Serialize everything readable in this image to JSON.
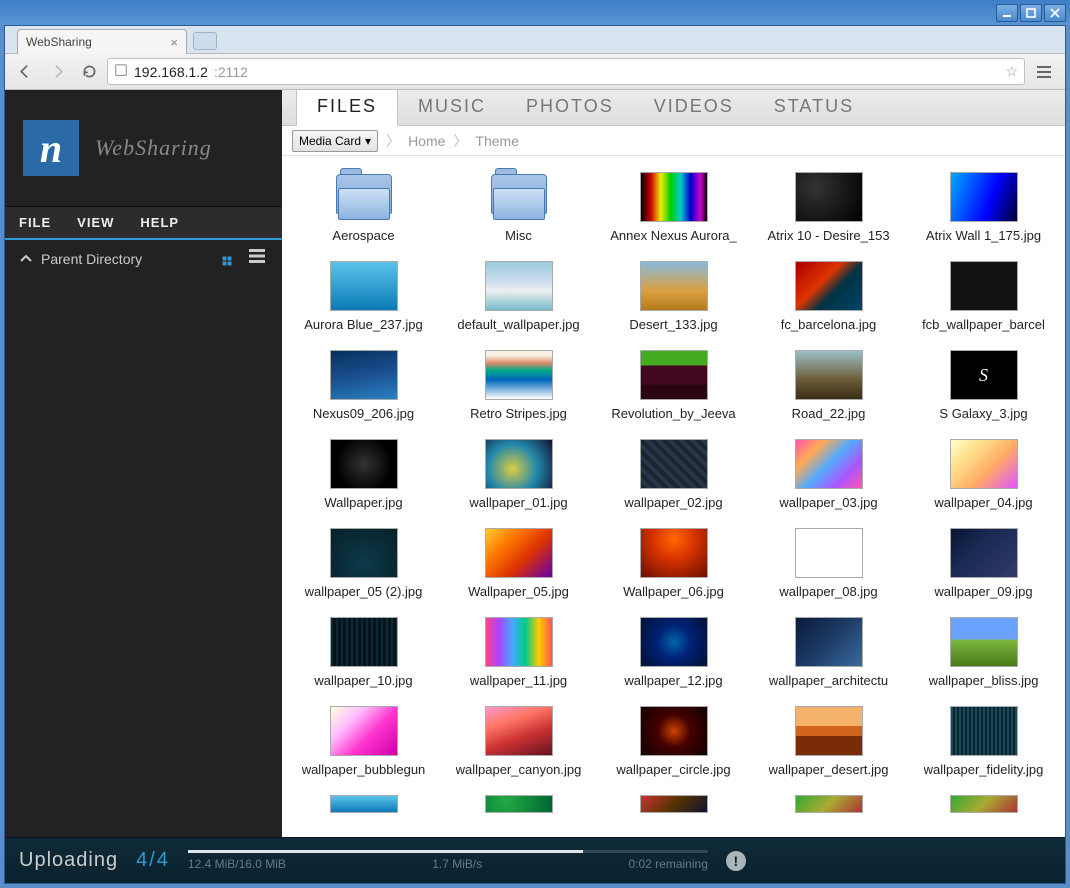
{
  "window": {
    "title": "WebSharing"
  },
  "browser": {
    "tab_title": "WebSharing",
    "url_host": "192.168.1.2",
    "url_port": ":2112"
  },
  "sidebar": {
    "app_name": "WebSharing",
    "menu": {
      "file": "FILE",
      "view": "VIEW",
      "help": "HELP"
    },
    "parent_dir": "Parent Directory"
  },
  "tabs": [
    {
      "id": "files",
      "label": "FILES",
      "active": true
    },
    {
      "id": "music",
      "label": "MUSIC",
      "active": false
    },
    {
      "id": "photos",
      "label": "PHOTOS",
      "active": false
    },
    {
      "id": "videos",
      "label": "VIDEOS",
      "active": false
    },
    {
      "id": "status",
      "label": "STATUS",
      "active": false
    }
  ],
  "breadcrumb": {
    "root_selector": "Media Card",
    "items": [
      "Home",
      "Theme"
    ]
  },
  "items": [
    {
      "name": "Aerospace",
      "type": "folder"
    },
    {
      "name": "Misc",
      "type": "folder"
    },
    {
      "name": "Annex Nexus Aurora_",
      "thumb": "t1"
    },
    {
      "name": "Atrix 10 - Desire_153",
      "thumb": "t2"
    },
    {
      "name": "Atrix Wall 1_175.jpg",
      "thumb": "t3"
    },
    {
      "name": "Aurora Blue_237.jpg",
      "thumb": "t4"
    },
    {
      "name": "default_wallpaper.jpg",
      "thumb": "t5"
    },
    {
      "name": "Desert_133.jpg",
      "thumb": "t6"
    },
    {
      "name": "fc_barcelona.jpg",
      "thumb": "t7"
    },
    {
      "name": "fcb_wallpaper_barcel",
      "thumb": "t8"
    },
    {
      "name": "Nexus09_206.jpg",
      "thumb": "t9"
    },
    {
      "name": "Retro Stripes.jpg",
      "thumb": "t10"
    },
    {
      "name": "Revolution_by_Jeeva",
      "thumb": "t11"
    },
    {
      "name": "Road_22.jpg",
      "thumb": "t12"
    },
    {
      "name": "S Galaxy_3.jpg",
      "thumb": "t13"
    },
    {
      "name": "Wallpaper.jpg",
      "thumb": "t14"
    },
    {
      "name": "wallpaper_01.jpg",
      "thumb": "t15"
    },
    {
      "name": "wallpaper_02.jpg",
      "thumb": "t16"
    },
    {
      "name": "wallpaper_03.jpg",
      "thumb": "t17"
    },
    {
      "name": "wallpaper_04.jpg",
      "thumb": "t18"
    },
    {
      "name": "wallpaper_05 (2).jpg",
      "thumb": "t19"
    },
    {
      "name": "Wallpaper_05.jpg",
      "thumb": "t20"
    },
    {
      "name": "Wallpaper_06.jpg",
      "thumb": "t21"
    },
    {
      "name": "wallpaper_08.jpg",
      "thumb": "t22"
    },
    {
      "name": "wallpaper_09.jpg",
      "thumb": "t23"
    },
    {
      "name": "wallpaper_10.jpg",
      "thumb": "t24"
    },
    {
      "name": "wallpaper_11.jpg",
      "thumb": "t25"
    },
    {
      "name": "wallpaper_12.jpg",
      "thumb": "t26"
    },
    {
      "name": "wallpaper_architectu",
      "thumb": "t27"
    },
    {
      "name": "wallpaper_bliss.jpg",
      "thumb": "t28"
    },
    {
      "name": "wallpaper_bubblegun",
      "thumb": "t29"
    },
    {
      "name": "wallpaper_canyon.jpg",
      "thumb": "t30"
    },
    {
      "name": "wallpaper_circle.jpg",
      "thumb": "t31"
    },
    {
      "name": "wallpaper_desert.jpg",
      "thumb": "t32"
    },
    {
      "name": "wallpaper_fidelity.jpg",
      "thumb": "t33"
    },
    {
      "name": "",
      "thumb": "t34",
      "partial": true
    },
    {
      "name": "",
      "thumb": "t35",
      "partial": true
    },
    {
      "name": "",
      "thumb": "t36",
      "partial": true
    },
    {
      "name": "",
      "thumb": "t37",
      "partial": true
    },
    {
      "name": "",
      "thumb": "t37",
      "partial": true
    }
  ],
  "upload": {
    "label": "Uploading",
    "count": "4/4",
    "size": "12.4 MiB/16.0 MiB",
    "rate": "1.7 MiB/s",
    "remaining": "0:02 remaining",
    "progress_pct": 76
  }
}
